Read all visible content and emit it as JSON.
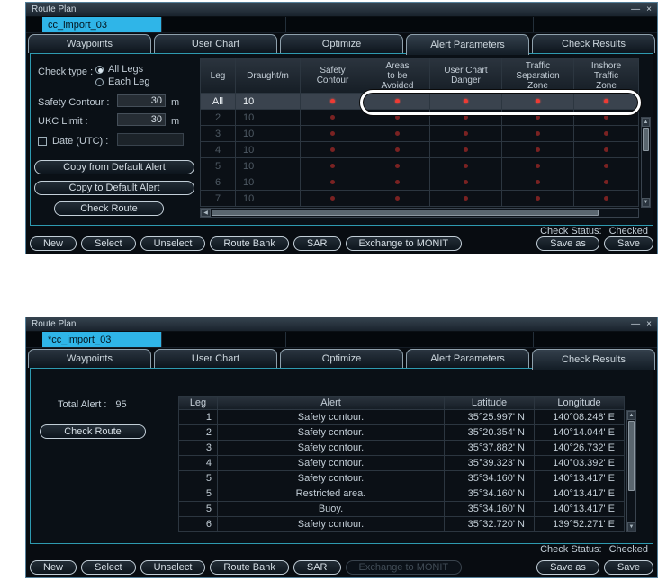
{
  "icons": {
    "minimize": "—",
    "close": "×",
    "scroll_up": "▲",
    "scroll_down": "▼",
    "scroll_left": "◀"
  },
  "colors": {
    "accent_cyan": "#2fb5e8",
    "panel_border": "#2e9ab0",
    "alert_dot_red": "#ef3b34",
    "alert_dot_dim": "#7a2222",
    "annotation": "#ffffff"
  },
  "top_window": {
    "title": "Route Plan",
    "route_name": "cc_import_03",
    "tabs": [
      "Waypoints",
      "User Chart",
      "Optimize",
      "Alert Parameters",
      "Check Results"
    ],
    "active_tab_index": 3,
    "form": {
      "check_type_label": "Check type :",
      "radio_all_legs": "All Legs",
      "radio_each_leg": "Each Leg",
      "selected_check_type": "All Legs",
      "safety_contour_label": "Safety Contour :",
      "safety_contour_value": "30",
      "safety_contour_unit": "m",
      "ukc_limit_label": "UKC Limit :",
      "ukc_limit_value": "30",
      "ukc_limit_unit": "m",
      "date_utc_label": "Date (UTC) :",
      "date_utc_checked": false,
      "date_utc_value": "",
      "copy_from_default_btn": "Copy from Default Alert",
      "copy_to_default_btn": "Copy to Default Alert",
      "check_route_btn": "Check Route"
    },
    "alert_table": {
      "headers": [
        "Leg",
        "Draught/m",
        "Safety\nContour",
        "Areas\nto be\nAvoided",
        "User Chart\nDanger",
        "Traffic\nSeparation\nZone",
        "Inshore\nTraffic\nZone"
      ],
      "rows": [
        {
          "leg": "All",
          "draught": "10",
          "alerts": [
            true,
            true,
            true,
            true,
            true
          ],
          "selected": true
        },
        {
          "leg": "2",
          "draught": "10",
          "alerts": [
            true,
            true,
            true,
            true,
            true
          ],
          "selected": false
        },
        {
          "leg": "3",
          "draught": "10",
          "alerts": [
            true,
            true,
            true,
            true,
            true
          ],
          "selected": false
        },
        {
          "leg": "4",
          "draught": "10",
          "alerts": [
            true,
            true,
            true,
            true,
            true
          ],
          "selected": false
        },
        {
          "leg": "5",
          "draught": "10",
          "alerts": [
            true,
            true,
            true,
            true,
            true
          ],
          "selected": false
        },
        {
          "leg": "6",
          "draught": "10",
          "alerts": [
            true,
            true,
            true,
            true,
            true
          ],
          "selected": false
        },
        {
          "leg": "7",
          "draught": "10",
          "alerts": [
            true,
            true,
            true,
            true,
            true
          ],
          "selected": false
        }
      ]
    },
    "check_status_label": "Check Status:",
    "check_status_value": "Checked",
    "footer_buttons": [
      {
        "label": "New"
      },
      {
        "label": "Select"
      },
      {
        "label": "Unselect"
      },
      {
        "label": "Route Bank"
      },
      {
        "label": "SAR"
      },
      {
        "label": "Exchange to MONIT"
      }
    ],
    "save_buttons": [
      {
        "label": "Save as"
      },
      {
        "label": "Save"
      }
    ]
  },
  "bottom_window": {
    "title": "Route Plan",
    "route_name": "*cc_import_03",
    "tabs": [
      "Waypoints",
      "User Chart",
      "Optimize",
      "Alert Parameters",
      "Check Results"
    ],
    "active_tab_index": 4,
    "total_alert_label": "Total Alert :",
    "total_alert_value": "95",
    "check_route_btn": "Check Route",
    "results_table": {
      "headers": [
        "Leg",
        "Alert",
        "Latitude",
        "Longitude"
      ],
      "rows": [
        [
          "1",
          "Safety contour.",
          "35°25.997' N",
          "140°08.248' E"
        ],
        [
          "2",
          "Safety contour.",
          "35°20.354' N",
          "140°14.044' E"
        ],
        [
          "3",
          "Safety contour.",
          "35°37.882' N",
          "140°26.732' E"
        ],
        [
          "4",
          "Safety contour.",
          "35°39.323' N",
          "140°03.392' E"
        ],
        [
          "5",
          "Safety contour.",
          "35°34.160' N",
          "140°13.417' E"
        ],
        [
          "5",
          "Restricted area.",
          "35°34.160' N",
          "140°13.417' E"
        ],
        [
          "5",
          "Buoy.",
          "35°34.160' N",
          "140°13.417' E"
        ],
        [
          "6",
          "Safety contour.",
          "35°32.720' N",
          "139°52.271' E"
        ]
      ]
    },
    "check_status_label": "Check Status:",
    "check_status_value": "Checked",
    "footer_buttons": [
      {
        "label": "New"
      },
      {
        "label": "Select"
      },
      {
        "label": "Unselect"
      },
      {
        "label": "Route Bank"
      },
      {
        "label": "SAR"
      },
      {
        "label": "Exchange to MONIT",
        "disabled": true
      }
    ],
    "save_buttons": [
      {
        "label": "Save as"
      },
      {
        "label": "Save"
      }
    ]
  }
}
